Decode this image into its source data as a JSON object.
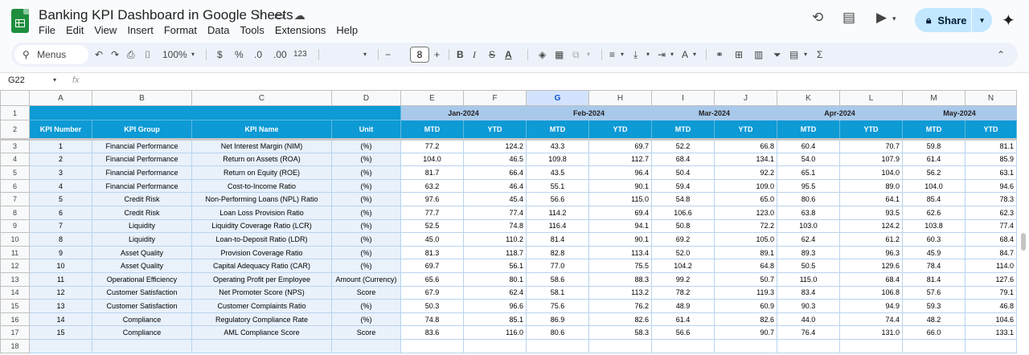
{
  "app": {
    "doc_title": "Banking KPI Dashboard in Google Sheets",
    "menu": [
      "File",
      "Edit",
      "View",
      "Insert",
      "Format",
      "Data",
      "Tools",
      "Extensions",
      "Help"
    ],
    "share_label": "Share"
  },
  "toolbar": {
    "menus_label": "Menus",
    "zoom": "100%",
    "currency": "$",
    "percent": "%",
    "dec_decrease": ".0",
    "dec_increase": ".00",
    "number_format": "123",
    "font_size": "8",
    "minus": "−",
    "plus": "+",
    "bold": "B",
    "italic": "I"
  },
  "formula_bar": {
    "cell_ref": "G22",
    "fx": "fx"
  },
  "columns": [
    "A",
    "B",
    "C",
    "D",
    "E",
    "F",
    "G",
    "H",
    "I",
    "J",
    "K",
    "L",
    "M",
    "N"
  ],
  "selected_column": "G",
  "header": {
    "kpi_number": "KPI Number",
    "kpi_group": "KPI Group",
    "kpi_name": "KPI Name",
    "unit": "Unit",
    "months": [
      "Jan-2024",
      "Feb-2024",
      "Mar-2024",
      "Apr-2024",
      "May-2024"
    ],
    "mtd": "MTD",
    "ytd": "YTD"
  },
  "rows": [
    {
      "row": "3",
      "num": "1",
      "group": "Financial Performance",
      "name": "Net Interest Margin (NIM)",
      "unit": "(%)",
      "v": [
        "77.2",
        "124.2",
        "43.3",
        "69.7",
        "52.2",
        "66.8",
        "60.4",
        "70.7",
        "59.8",
        "81.1"
      ]
    },
    {
      "row": "4",
      "num": "2",
      "group": "Financial Performance",
      "name": "Return on Assets (ROA)",
      "unit": "(%)",
      "v": [
        "104.0",
        "46.5",
        "109.8",
        "112.7",
        "68.4",
        "134.1",
        "54.0",
        "107.9",
        "61.4",
        "85.9"
      ]
    },
    {
      "row": "5",
      "num": "3",
      "group": "Financial Performance",
      "name": "Return on Equity (ROE)",
      "unit": "(%)",
      "v": [
        "81.7",
        "66.4",
        "43.5",
        "96.4",
        "50.4",
        "92.2",
        "65.1",
        "104.0",
        "56.2",
        "63.1"
      ]
    },
    {
      "row": "6",
      "num": "4",
      "group": "Financial Performance",
      "name": "Cost-to-Income Ratio",
      "unit": "(%)",
      "v": [
        "63.2",
        "46.4",
        "55.1",
        "90.1",
        "59.4",
        "109.0",
        "95.5",
        "89.0",
        "104.0",
        "94.6"
      ]
    },
    {
      "row": "7",
      "num": "5",
      "group": "Credit Risk",
      "name": "Non-Performing Loans (NPL) Ratio",
      "unit": "(%)",
      "v": [
        "97.6",
        "45.4",
        "56.6",
        "115.0",
        "54.8",
        "65.0",
        "80.6",
        "64.1",
        "85.4",
        "78.3"
      ]
    },
    {
      "row": "8",
      "num": "6",
      "group": "Credit Risk",
      "name": "Loan Loss Provision Ratio",
      "unit": "(%)",
      "v": [
        "77.7",
        "77.4",
        "114.2",
        "69.4",
        "106.6",
        "123.0",
        "63.8",
        "93.5",
        "62.6",
        "62.3"
      ]
    },
    {
      "row": "9",
      "num": "7",
      "group": "Liquidity",
      "name": "Liquidity Coverage Ratio (LCR)",
      "unit": "(%)",
      "v": [
        "52.5",
        "74.8",
        "116.4",
        "94.1",
        "50.8",
        "72.2",
        "103.0",
        "124.2",
        "103.8",
        "77.4"
      ]
    },
    {
      "row": "10",
      "num": "8",
      "group": "Liquidity",
      "name": "Loan-to-Deposit Ratio (LDR)",
      "unit": "(%)",
      "v": [
        "45.0",
        "110.2",
        "81.4",
        "90.1",
        "69.2",
        "105.0",
        "62.4",
        "61.2",
        "60.3",
        "68.4"
      ]
    },
    {
      "row": "11",
      "num": "9",
      "group": "Asset Quality",
      "name": "Provision Coverage Ratio",
      "unit": "(%)",
      "v": [
        "81.3",
        "118.7",
        "82.8",
        "113.4",
        "52.0",
        "89.1",
        "89.3",
        "96.3",
        "45.9",
        "84.7"
      ]
    },
    {
      "row": "12",
      "num": "10",
      "group": "Asset Quality",
      "name": "Capital Adequacy Ratio (CAR)",
      "unit": "(%)",
      "v": [
        "69.7",
        "56.1",
        "77.0",
        "75.5",
        "104.2",
        "64.8",
        "50.5",
        "129.6",
        "78.4",
        "114.0"
      ]
    },
    {
      "row": "13",
      "num": "11",
      "group": "Operational Efficiency",
      "name": "Operating Profit per Employee",
      "unit": "Amount (Currency)",
      "v": [
        "65.6",
        "80.1",
        "58.6",
        "88.3",
        "99.2",
        "50.7",
        "115.0",
        "68.4",
        "81.4",
        "127.6"
      ]
    },
    {
      "row": "14",
      "num": "12",
      "group": "Customer Satisfaction",
      "name": "Net Promoter Score (NPS)",
      "unit": "Score",
      "v": [
        "67.9",
        "62.4",
        "58.1",
        "113.2",
        "78.2",
        "119.3",
        "83.4",
        "106.8",
        "57.6",
        "79.1"
      ]
    },
    {
      "row": "15",
      "num": "13",
      "group": "Customer Satisfaction",
      "name": "Customer Complaints Ratio",
      "unit": "(%)",
      "v": [
        "50.3",
        "96.6",
        "75.6",
        "76.2",
        "48.9",
        "60.9",
        "90.3",
        "94.9",
        "59.3",
        "46.8"
      ]
    },
    {
      "row": "16",
      "num": "14",
      "group": "Compliance",
      "name": "Regulatory Compliance Rate",
      "unit": "(%)",
      "v": [
        "74.8",
        "85.1",
        "86.9",
        "82.6",
        "61.4",
        "82.6",
        "44.0",
        "74.4",
        "48.2",
        "104.6"
      ]
    },
    {
      "row": "17",
      "num": "15",
      "group": "Compliance",
      "name": "AML Compliance Score",
      "unit": "Score",
      "v": [
        "83.6",
        "116.0",
        "80.6",
        "58.3",
        "56.6",
        "90.7",
        "76.4",
        "131.0",
        "66.0",
        "133.1"
      ]
    }
  ],
  "empty_row": "18",
  "row_labels": {
    "r1": "1",
    "r2": "2"
  }
}
